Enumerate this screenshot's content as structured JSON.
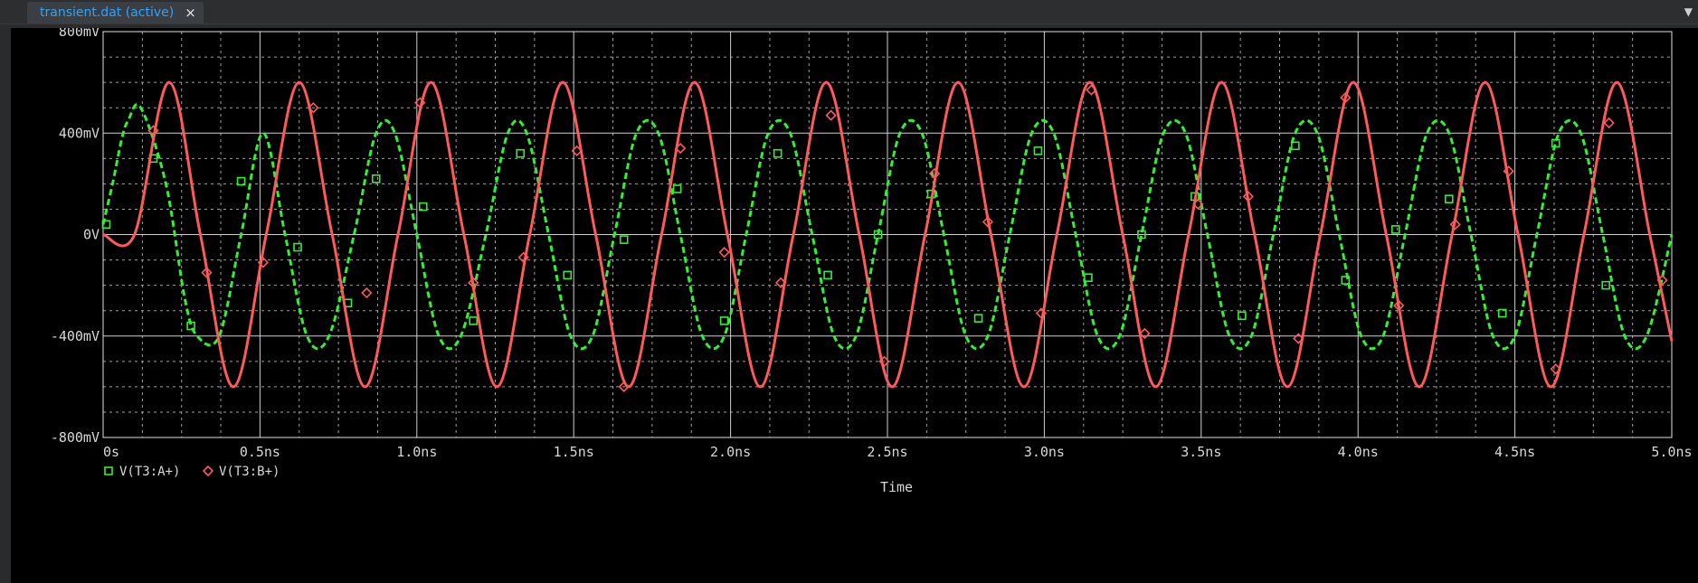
{
  "tab": {
    "label": "transient.dat (active)",
    "close": "×",
    "menu": "▼"
  },
  "chart_data": {
    "type": "line",
    "title": "",
    "xlabel": "Time",
    "ylabel": "",
    "xlim": [
      0,
      5.0
    ],
    "ylim": [
      -800,
      800
    ],
    "x_unit": "ns",
    "y_unit": "mV",
    "grid": true,
    "x_ticks": [
      0,
      0.5,
      1.0,
      1.5,
      2.0,
      2.5,
      3.0,
      3.5,
      4.0,
      4.5,
      5.0
    ],
    "x_tick_labels": [
      "0s",
      "0.5ns",
      "1.0ns",
      "1.5ns",
      "2.0ns",
      "2.5ns",
      "3.0ns",
      "3.5ns",
      "4.0ns",
      "4.5ns",
      "5.0ns"
    ],
    "y_ticks": [
      800,
      400,
      0,
      -400,
      -800
    ],
    "y_tick_labels": [
      "800mV",
      "400mV",
      "0V",
      "-400mV",
      "-800mV"
    ],
    "legend_position": "bottom-left",
    "series": [
      {
        "name": "V(T3:A+)",
        "color": "#33ee33",
        "style": "dashed",
        "marker": "square",
        "x": [
          0,
          0.03,
          0.06,
          0.08,
          0.12,
          0.2,
          0.26,
          0.3,
          0.37,
          0.44,
          0.51,
          0.58,
          0.65,
          0.72,
          0.8,
          0.87,
          0.93,
          1.0,
          1.07,
          1.14,
          1.22,
          1.29,
          1.35,
          1.42,
          1.49,
          1.56,
          1.63,
          1.7,
          1.77,
          1.84,
          1.91,
          1.98,
          2.05,
          2.12,
          2.19,
          2.26,
          2.33,
          2.4,
          2.47,
          2.54,
          2.61,
          2.68,
          2.75,
          2.82,
          2.89,
          2.96,
          3.03,
          3.1,
          3.17,
          3.24,
          3.31,
          3.38,
          3.45,
          3.52,
          3.59,
          3.66,
          3.73,
          3.8,
          3.87,
          3.94,
          4.01,
          4.08,
          4.15,
          4.22,
          4.29,
          4.36,
          4.43,
          4.5,
          4.57,
          4.64,
          4.71,
          4.78,
          4.85,
          4.92,
          5.0
        ],
        "y": [
          40,
          200,
          380,
          450,
          500,
          200,
          -250,
          -400,
          -400,
          0,
          400,
          0,
          -400,
          -400,
          0,
          400,
          400,
          0,
          -400,
          -400,
          0,
          400,
          400,
          0,
          -400,
          -400,
          0,
          400,
          400,
          0,
          -400,
          -400,
          0,
          400,
          400,
          0,
          -400,
          -400,
          0,
          400,
          400,
          0,
          -400,
          -400,
          0,
          400,
          400,
          0,
          -400,
          -400,
          0,
          400,
          400,
          0,
          -400,
          -400,
          0,
          400,
          400,
          0,
          -400,
          -400,
          0,
          400,
          400,
          0,
          -400,
          -400,
          0,
          400,
          400,
          0,
          -400,
          -400,
          0
        ],
        "markers_x": [
          0.01,
          0.16,
          0.28,
          0.44,
          0.62,
          0.78,
          0.87,
          1.02,
          1.18,
          1.33,
          1.48,
          1.66,
          1.83,
          1.98,
          2.15,
          2.31,
          2.47,
          2.64,
          2.79,
          2.98,
          3.14,
          3.31,
          3.48,
          3.63,
          3.8,
          3.96,
          4.12,
          4.29,
          4.46,
          4.63,
          4.79
        ],
        "markers_y": [
          40,
          300,
          -360,
          210,
          -50,
          -270,
          220,
          110,
          -340,
          320,
          -160,
          -20,
          180,
          -340,
          320,
          -160,
          0,
          160,
          -330,
          330,
          -170,
          0,
          150,
          -320,
          350,
          -180,
          20,
          140,
          -310,
          360,
          -200
        ]
      },
      {
        "name": "V(T3:B+)",
        "color": "#ff5a5a",
        "style": "solid",
        "marker": "diamond",
        "x": [
          0,
          0.1,
          0.21,
          0.31,
          0.415,
          0.52,
          0.625,
          0.73,
          0.835,
          0.94,
          1.045,
          1.15,
          1.255,
          1.36,
          1.465,
          1.57,
          1.675,
          1.78,
          1.885,
          1.99,
          2.095,
          2.2,
          2.305,
          2.41,
          2.515,
          2.62,
          2.725,
          2.83,
          2.935,
          3.04,
          3.145,
          3.25,
          3.355,
          3.46,
          3.565,
          3.67,
          3.775,
          3.88,
          3.985,
          4.09,
          4.195,
          4.3,
          4.405,
          4.51,
          4.615,
          4.72,
          4.825,
          4.93,
          5.0
        ],
        "y": [
          0,
          0,
          600,
          0,
          -600,
          0,
          600,
          0,
          -600,
          0,
          600,
          0,
          -600,
          0,
          600,
          0,
          -600,
          0,
          600,
          0,
          -600,
          0,
          600,
          0,
          -600,
          0,
          600,
          0,
          -600,
          0,
          600,
          0,
          -600,
          0,
          600,
          0,
          -600,
          0,
          600,
          0,
          -600,
          0,
          600,
          0,
          -600,
          0,
          600,
          0,
          -420
        ],
        "markers_x": [
          0.16,
          0.33,
          0.51,
          0.67,
          0.84,
          1.01,
          1.18,
          1.34,
          1.51,
          1.66,
          1.84,
          1.98,
          2.16,
          2.32,
          2.49,
          2.65,
          2.82,
          2.99,
          3.15,
          3.32,
          3.49,
          3.65,
          3.81,
          3.96,
          4.13,
          4.31,
          4.48,
          4.63,
          4.8,
          4.97
        ],
        "markers_y": [
          410,
          -150,
          -110,
          500,
          -230,
          520,
          -190,
          -90,
          330,
          -600,
          340,
          -70,
          -190,
          470,
          -500,
          240,
          50,
          -310,
          570,
          -390,
          120,
          150,
          -410,
          540,
          -280,
          40,
          250,
          -530,
          440,
          -180
        ]
      }
    ]
  }
}
